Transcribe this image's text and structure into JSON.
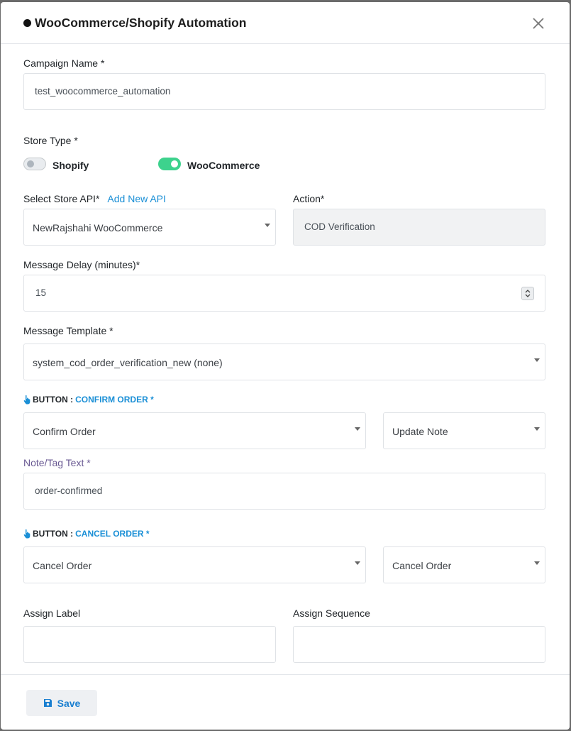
{
  "modal": {
    "title": "WooCommerce/Shopify Automation"
  },
  "campaign": {
    "label": "Campaign Name *",
    "value": "test_woocommerce_automation"
  },
  "store_type": {
    "label": "Store Type *",
    "options": [
      {
        "label": "Shopify",
        "on": false
      },
      {
        "label": "WooCommerce",
        "on": true
      }
    ]
  },
  "store_api": {
    "label": "Select Store API*",
    "add_link": "Add New API",
    "value": "NewRajshahi WooCommerce"
  },
  "action": {
    "label": "Action*",
    "value": "COD Verification"
  },
  "delay": {
    "label": "Message Delay (minutes)*",
    "value": "15"
  },
  "template": {
    "label": "Message Template *",
    "value": "system_cod_order_verification_new (none)"
  },
  "confirm_button": {
    "prefix": "BUTTON :",
    "name": "CONFIRM ORDER *",
    "action_value": "Confirm Order",
    "secondary_value": "Update Note",
    "note_label": "Note/Tag Text *",
    "note_value": "order-confirmed"
  },
  "cancel_button": {
    "prefix": "BUTTON :",
    "name": "CANCEL ORDER *",
    "action_value": "Cancel Order",
    "secondary_value": "Cancel Order"
  },
  "assign_label": {
    "label": "Assign Label",
    "value": ""
  },
  "assign_sequence": {
    "label": "Assign Sequence",
    "value": ""
  },
  "footer": {
    "save_label": "Save"
  },
  "colors": {
    "accent": "#1a8fd6",
    "toggle_on": "#3dd28d"
  },
  "icons": [
    "close-icon",
    "hand-pointer-icon",
    "save-icon",
    "spinner-arrows-icon",
    "caret-down-icon"
  ]
}
